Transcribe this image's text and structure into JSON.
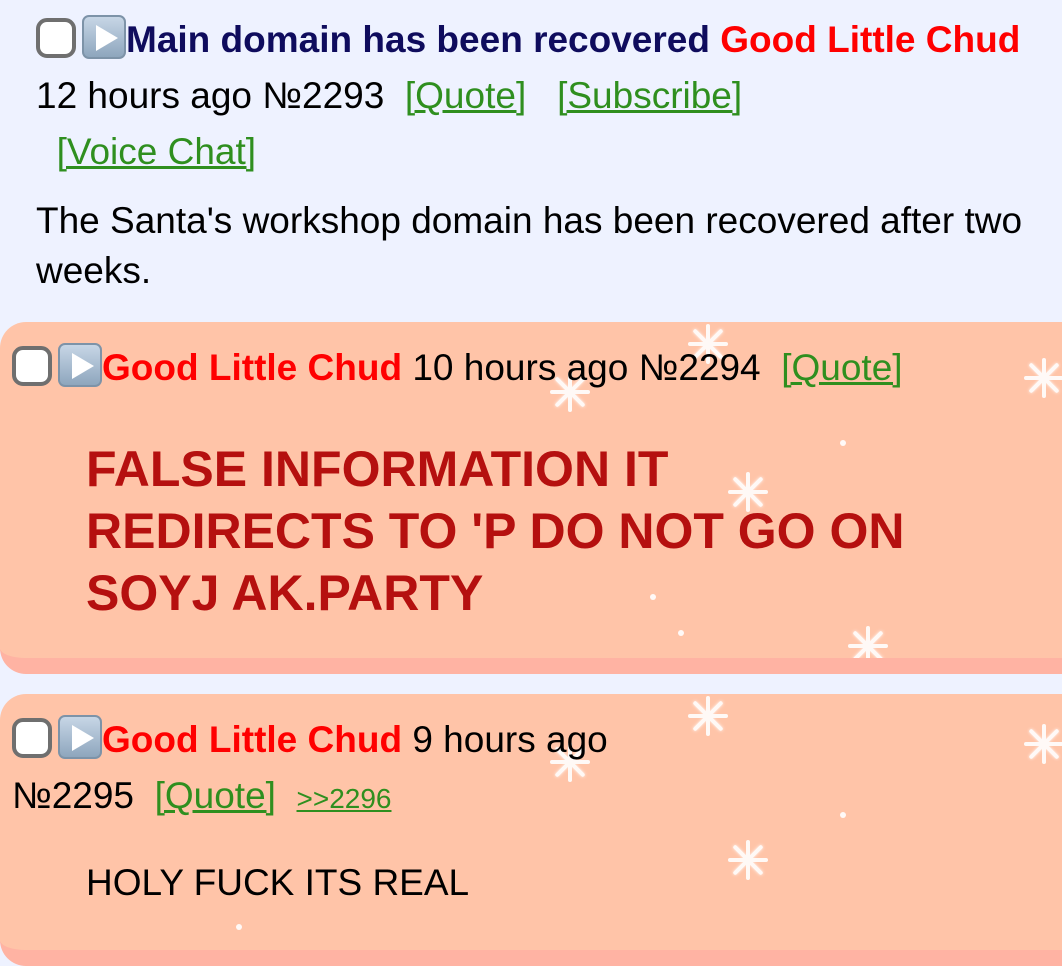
{
  "op": {
    "subject": "Main domain has been recovered",
    "name": "Good Little Chud",
    "time": "12 hours ago",
    "number": "№2293",
    "links": {
      "quote": "[Quote]",
      "subscribe": "[Subscribe]",
      "voice_chat": "[Voice Chat]"
    },
    "body": "The Santa's workshop domain has been recovered after two weeks."
  },
  "replies": [
    {
      "name": "Good Little Chud",
      "time": "10 hours ago",
      "number": "№2294",
      "quote": "[Quote]",
      "body": "FALSE INFORMATION IT REDIRECTS TO 'P DO NOT GO ON SOYJ AK.PARTY",
      "body_color": "#b5100f"
    },
    {
      "name": "Good Little Chud",
      "time": "9 hours ago",
      "number": "№2295",
      "quote": "[Quote]",
      "backlink": ">>2296",
      "body": "HOLY FUCK ITS REAL"
    }
  ],
  "colors": {
    "page_background": "#eef2ff",
    "reply_background": "#ffc4a8",
    "subject": "#0f0c5d",
    "name": "#ff0000",
    "link": "#2f8f1f"
  },
  "icons": [
    "checkbox-icon",
    "play-icon",
    "snowflake-icon"
  ]
}
